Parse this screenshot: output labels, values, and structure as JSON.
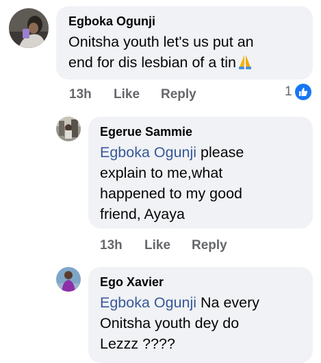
{
  "comments": [
    {
      "author": "Egboka Ogunji",
      "lines": [
        "Onitsha youth let's us put an",
        "end for dis lesbian of a tin"
      ],
      "emoji": "pray-emoji",
      "time": "13h",
      "like_label": "Like",
      "reply_label": "Reply",
      "reaction_count": "1",
      "reaction_icon": "like-icon"
    },
    {
      "author": "Egerue Sammie",
      "mention": "Egboka Ogunji",
      "first_line_rest": " please",
      "lines": [
        "explain to me,what",
        "happened to my good",
        "friend, Ayaya"
      ],
      "time": "13h",
      "like_label": "Like",
      "reply_label": "Reply"
    },
    {
      "author": "Ego Xavier",
      "mention": "Egboka Ogunji",
      "first_line_rest": " Na every",
      "lines": [
        "Onitsha youth dey do",
        "Lezzz ????"
      ]
    }
  ],
  "colors": {
    "bubble": "#f0f2f5",
    "mention": "#385898",
    "meta": "#65676b",
    "like_badge": "#1877f2"
  }
}
